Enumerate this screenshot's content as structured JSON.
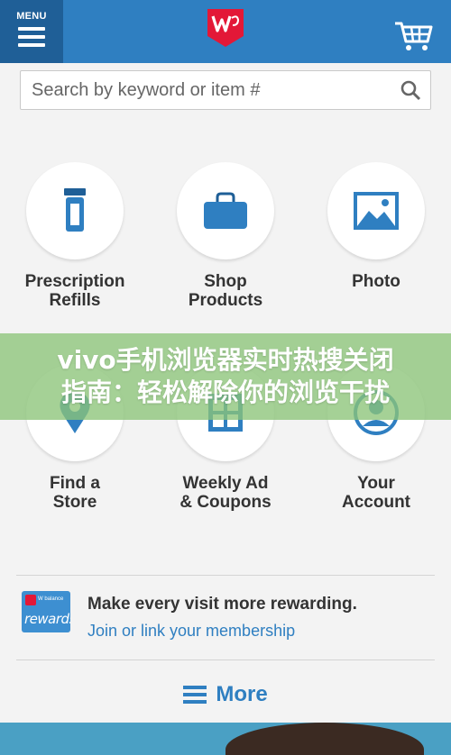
{
  "header": {
    "menu_label": "MENU",
    "brand_color": "#2f7fc1",
    "logo_color": "#e31837",
    "logo_letter": "W"
  },
  "search": {
    "placeholder": "Search by keyword or item #"
  },
  "tiles": [
    {
      "label": "Prescription\nRefills",
      "icon": "pill-bottle-icon"
    },
    {
      "label": "Shop\nProducts",
      "icon": "shopping-bag-icon"
    },
    {
      "label": "Photo",
      "icon": "photo-icon"
    },
    {
      "label": "Find a\nStore",
      "icon": "location-pin-icon"
    },
    {
      "label": "Weekly Ad\n& Coupons",
      "icon": "weekly-ad-icon"
    },
    {
      "label": "Your\nAccount",
      "icon": "account-icon"
    }
  ],
  "overlay": {
    "line1": "vivo手机浏览器实时热搜关闭",
    "line2": "指南：轻松解除你的浏览干扰"
  },
  "rewards": {
    "card_small": "W balance",
    "card_text": "rewards",
    "title": "Make every visit more rewarding.",
    "link": "Join or link your membership"
  },
  "more": {
    "label": "More"
  }
}
